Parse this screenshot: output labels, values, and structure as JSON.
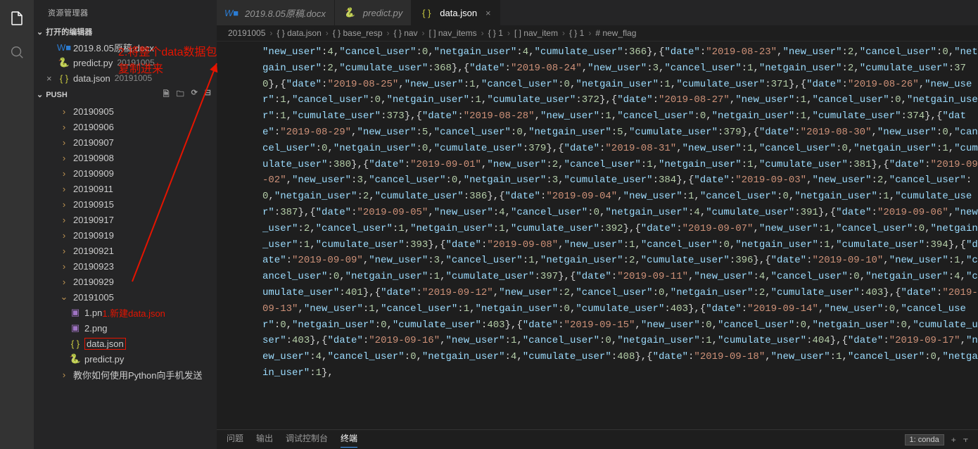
{
  "sidebar": {
    "title": "资源管理器",
    "openEditorsHeader": "打开的编辑器",
    "openEditors": [
      {
        "icon": "word",
        "name": "2019.8.05原稿.docx",
        "closable": false
      },
      {
        "icon": "py",
        "name": "predict.py",
        "dim": "20191005",
        "closable": false
      },
      {
        "icon": "json",
        "name": "data.json",
        "dim": "20191005",
        "closable": true
      }
    ],
    "workspaceHeader": "PUSH",
    "tree": [
      {
        "depth": 1,
        "type": "folder",
        "name": "20190905"
      },
      {
        "depth": 1,
        "type": "folder",
        "name": "20190906"
      },
      {
        "depth": 1,
        "type": "folder",
        "name": "20190907"
      },
      {
        "depth": 1,
        "type": "folder",
        "name": "20190908"
      },
      {
        "depth": 1,
        "type": "folder",
        "name": "20190909"
      },
      {
        "depth": 1,
        "type": "folder",
        "name": "20190911"
      },
      {
        "depth": 1,
        "type": "folder",
        "name": "20190915"
      },
      {
        "depth": 1,
        "type": "folder",
        "name": "20190917"
      },
      {
        "depth": 1,
        "type": "folder",
        "name": "20190919"
      },
      {
        "depth": 1,
        "type": "folder",
        "name": "20190921"
      },
      {
        "depth": 1,
        "type": "folder",
        "name": "20190923"
      },
      {
        "depth": 1,
        "type": "folder",
        "name": "20190929"
      },
      {
        "depth": 1,
        "type": "folder-open",
        "name": "20191005"
      },
      {
        "depth": 2,
        "type": "img",
        "name": "1.png",
        "ann": "1.新建data.json",
        "annOffset": 4
      },
      {
        "depth": 2,
        "type": "img",
        "name": "2.png"
      },
      {
        "depth": 2,
        "type": "json",
        "name": "data.json",
        "boxed": true
      },
      {
        "depth": 2,
        "type": "py",
        "name": "predict.py"
      },
      {
        "depth": 1,
        "type": "folder",
        "name": "教你如何使用Python向手机发送"
      }
    ]
  },
  "tabs": [
    {
      "icon": "word",
      "name": "2019.8.05原稿.docx"
    },
    {
      "icon": "py",
      "name": "predict.py"
    },
    {
      "icon": "json",
      "name": "data.json",
      "active": true,
      "close": true
    }
  ],
  "breadcrumb": [
    "20191005",
    "{ } data.json",
    "{ } base_resp",
    "{ } nav",
    "[ ] nav_items",
    "{ } 1",
    "[ ] nav_item",
    "{ } 1",
    "# new_flag"
  ],
  "annotation2": "2.将整个data数据包\n复制进来",
  "code_entries": [
    {
      "pre": "",
      "nu": 4,
      "cu": 0,
      "ng": 4,
      "cm": 366,
      "post": ","
    },
    {
      "d": "2019-08-23",
      "nu": 2,
      "cu": 0,
      "ng": 2,
      "cm": 368,
      "post": ","
    },
    {
      "d": "2019-08-24",
      "nu": 3,
      "cu": 1,
      "ng": 2,
      "cm": 370,
      "post": ","
    },
    {
      "d": "2019-08-25",
      "nu": 1,
      "cu": 0,
      "ng": 1,
      "cm": 371,
      "post": ","
    },
    {
      "d": "2019-08-26",
      "nu": 1,
      "cu": 0,
      "ng": 1,
      "cm": 372,
      "post": ","
    },
    {
      "d": "2019-08-27",
      "nu": 1,
      "cu": 0,
      "ng": 1,
      "cm": 373,
      "post": ","
    },
    {
      "d": "2019-08-28",
      "nu": 1,
      "cu": 0,
      "ng": 1,
      "cm": 374,
      "post": ","
    },
    {
      "d": "2019-08-29",
      "nu": 5,
      "cu": 0,
      "ng": 5,
      "cm": 379,
      "post": ","
    },
    {
      "d": "2019-08-30",
      "nu": 0,
      "cu": 0,
      "ng": 0,
      "cm": 379,
      "post": ","
    },
    {
      "d": "2019-08-31",
      "nu": 1,
      "cu": 0,
      "ng": 1,
      "cm": 380,
      "post": ","
    },
    {
      "d": "2019-09-01",
      "nu": 2,
      "cu": 1,
      "ng": 1,
      "cm": 381,
      "post": ","
    },
    {
      "d": "2019-09-02",
      "nu": 3,
      "cu": 0,
      "ng": 3,
      "cm": 384,
      "post": ","
    },
    {
      "d": "2019-09-03",
      "nu": 2,
      "cu": 0,
      "ng": 2,
      "cm": 386,
      "post": ","
    },
    {
      "d": "2019-09-04",
      "nu": 1,
      "cu": 0,
      "ng": 1,
      "cm": 387,
      "post": ","
    },
    {
      "d": "2019-09-05",
      "nu": 4,
      "cu": 0,
      "ng": 4,
      "cm": 391,
      "post": ","
    },
    {
      "d": "2019-09-06",
      "nu": 2,
      "cu": 1,
      "ng": 1,
      "cm": 392,
      "post": ","
    },
    {
      "d": "2019-09-07",
      "nu": 1,
      "cu": 0,
      "ng": 1,
      "cm": 393,
      "post": ","
    },
    {
      "d": "2019-09-08",
      "nu": 1,
      "cu": 0,
      "ng": 1,
      "cm": 394,
      "post": ","
    },
    {
      "d": "2019-09-09",
      "nu": 3,
      "cu": 1,
      "ng": 2,
      "cm": 396,
      "post": ","
    },
    {
      "d": "2019-09-10",
      "nu": 1,
      "cu": 0,
      "ng": 1,
      "cm": 397,
      "post": ","
    },
    {
      "d": "2019-09-11",
      "nu": 4,
      "cu": 0,
      "ng": 4,
      "cm": 401,
      "post": ","
    },
    {
      "d": "2019-09-12",
      "nu": 2,
      "cu": 0,
      "ng": 2,
      "cm": 403,
      "post": ","
    },
    {
      "d": "2019-09-13",
      "nu": 1,
      "cu": 1,
      "ng": 0,
      "cm": 403,
      "post": ","
    },
    {
      "d": "2019-09-14",
      "nu": 0,
      "cu": 0,
      "ng": 0,
      "cm": 403,
      "post": ","
    },
    {
      "d": "2019-09-15",
      "nu": 0,
      "cu": 0,
      "ng": 0,
      "cm": 403,
      "post": ","
    },
    {
      "d": "2019-09-16",
      "nu": 1,
      "cu": 0,
      "ng": 1,
      "cm": 404,
      "post": ","
    },
    {
      "d": "2019-09-17",
      "nu": 4,
      "cu": 0,
      "ng": 4,
      "cm": 408,
      "post": ","
    },
    {
      "d": "2019-09-18",
      "nu": 1,
      "cu": 0,
      "ng": 1,
      "post": ","
    }
  ],
  "terminal": {
    "tabs": [
      "问题",
      "输出",
      "调试控制台",
      "终端"
    ],
    "activeTab": 3,
    "selector": "1: conda"
  }
}
